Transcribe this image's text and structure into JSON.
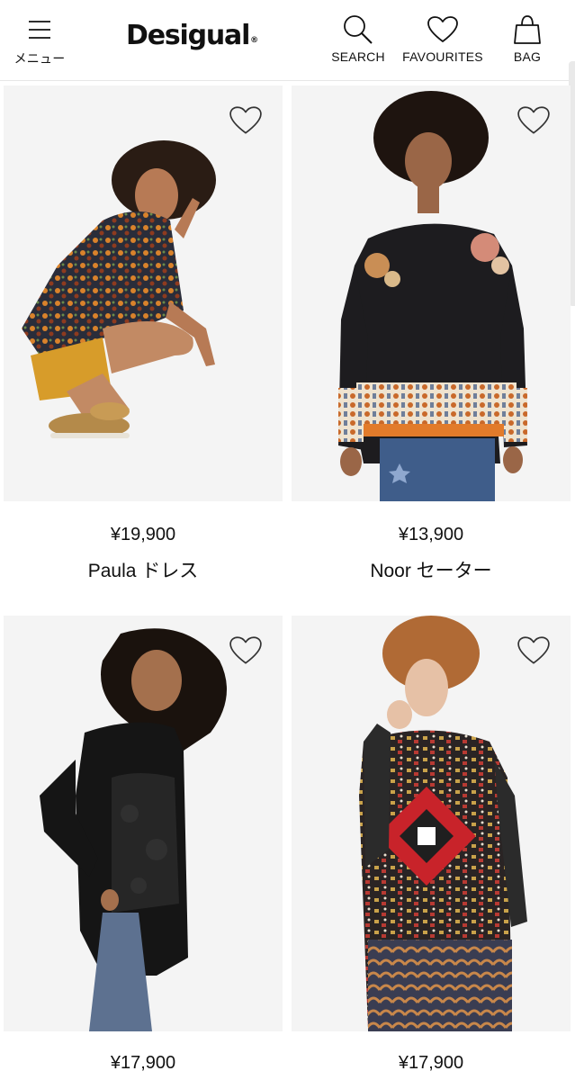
{
  "header": {
    "menu_label": "メニュー",
    "logo_text": "Desigual",
    "logo_reg": "®",
    "search_label": "SEARCH",
    "favourites_label": "FAVOURITES",
    "bag_label": "BAG"
  },
  "products": [
    {
      "price": "¥19,900",
      "name": "Paula ドレス"
    },
    {
      "price": "¥13,900",
      "name": "Noor セーター"
    },
    {
      "price": "¥17,900",
      "name": ""
    },
    {
      "price": "¥17,900",
      "name": ""
    }
  ],
  "colors": {
    "text": "#111111",
    "image_bg": "#f4f4f4",
    "divider": "#e6e6e6"
  }
}
